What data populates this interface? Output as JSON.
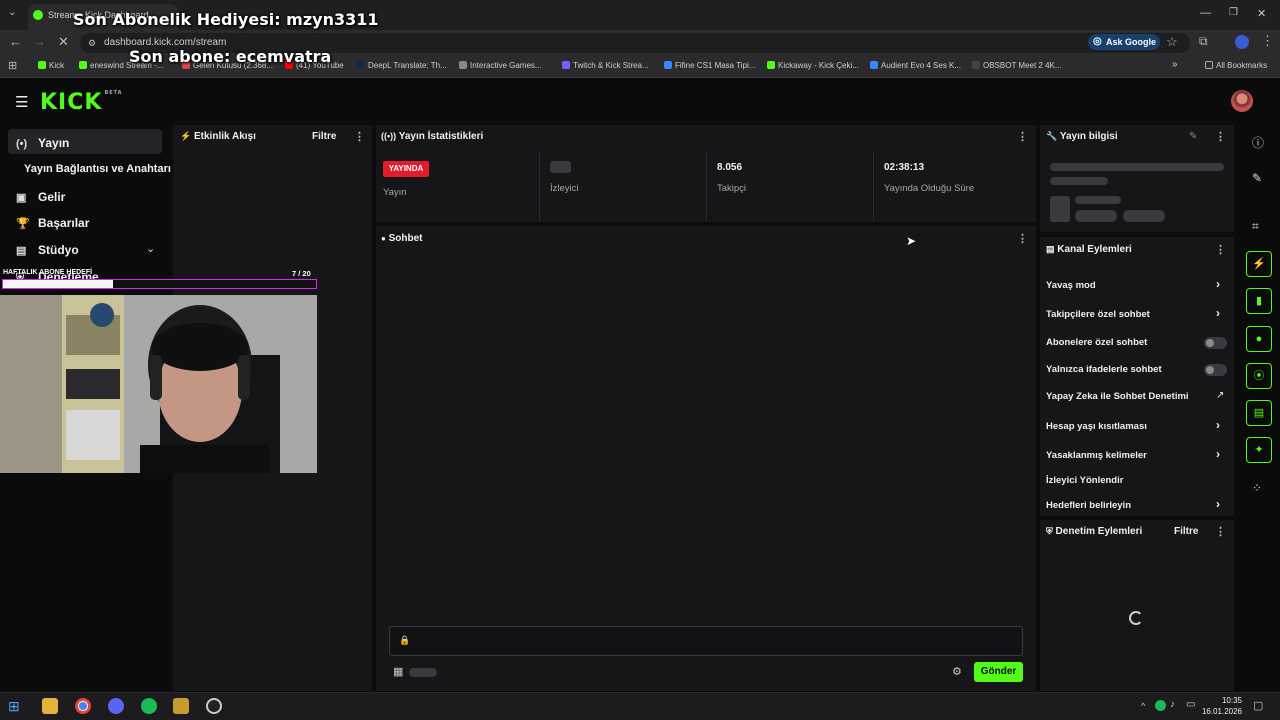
{
  "browser": {
    "tab_title": "Stream - Kick Dashboard",
    "url": "dashboard.kick.com/stream",
    "ask_google": "Ask Google",
    "all_bookmarks": "All Bookmarks",
    "bookmarks": [
      "Kick",
      "eneswind Stream -...",
      "Gelen Kutusu (2.368...",
      "(41) YouTube",
      "DeepL Translate: Th...",
      "Interactive Games...",
      "Twitch & Kick Strea...",
      "Fifine CS1 Masa Tipi...",
      "Kickaway - Kick Çeki...",
      "Audient Evo 4 Ses K...",
      "OBSBOT Meet 2 4K..."
    ]
  },
  "header": {
    "logo": "KICK",
    "logo_badge": "BETA"
  },
  "sidebar": {
    "items": [
      {
        "label": "Yayın",
        "icon": "broadcast-icon"
      },
      {
        "label": "Yayın Bağlantısı ve Anahtarı",
        "icon": ""
      },
      {
        "label": "Gelir",
        "icon": "money-icon"
      },
      {
        "label": "Başarılar",
        "icon": "trophy-icon"
      },
      {
        "label": "Stüdyo",
        "icon": "studio-icon"
      },
      {
        "label": "Denetleme",
        "icon": "shield-icon"
      }
    ]
  },
  "activity": {
    "title": "Etkinlik Akışı",
    "filter": "Filtre"
  },
  "stats": {
    "title": "Yayın İstatistikleri",
    "live_badge": "YAYINDA",
    "stream_label": "Yayın",
    "viewers_label": "İzleyici",
    "followers_value": "8.056",
    "followers_label": "Takipçi",
    "uptime_value": "02:38:13",
    "uptime_label": "Yayında Olduğu Süre"
  },
  "chat": {
    "title": "Sohbet",
    "send": "Gönder"
  },
  "stream_info": {
    "title": "Yayın bilgisi"
  },
  "channel_actions": {
    "title": "Kanal Eylemleri",
    "items": [
      {
        "label": "Yavaş mod",
        "control": "chevron"
      },
      {
        "label": "Takipçilere özel sohbet",
        "control": "chevron"
      },
      {
        "label": "Abonelere özel sohbet",
        "control": "toggle",
        "on": false
      },
      {
        "label": "Yalnızca ifadelerle sohbet",
        "control": "toggle",
        "on": false
      },
      {
        "label": "Yapay Zeka ile Sohbet Denetimi",
        "control": "external"
      },
      {
        "label": "Hesap yaşı kısıtlaması",
        "control": "chevron"
      },
      {
        "label": "Yasaklanmış kelimeler",
        "control": "chevron"
      },
      {
        "label": "İzleyici Yönlendir",
        "control": "none"
      },
      {
        "label": "Hedefleri belirleyin",
        "control": "chevron"
      }
    ]
  },
  "mod_actions": {
    "title": "Denetim Eylemleri",
    "filter": "Filtre"
  },
  "overlay": {
    "last_gift": "Son Abonelik Hediyesi: mzyn3311",
    "last_sub": "Son abone: ecemvatra",
    "goal_label": "HAFTALIK ABONE HEDEFİ",
    "goal_count": "7 / 20",
    "goal_current": 7,
    "goal_target": 20
  },
  "taskbar": {
    "time": "10:35",
    "date": "16.01.2026"
  },
  "colors": {
    "accent": "#53fc18",
    "live": "#e31c2d",
    "panel": "#161618"
  }
}
